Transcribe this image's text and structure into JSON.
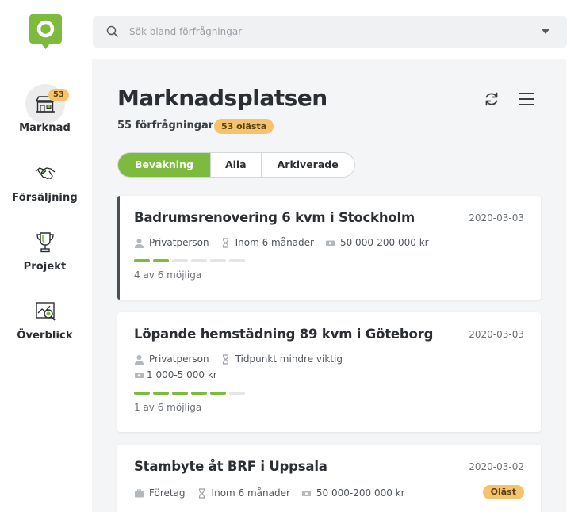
{
  "sidebar": {
    "items": [
      {
        "label": "Marknad",
        "badge": "53",
        "icon": "market-stall-icon",
        "active": true
      },
      {
        "label": "Försäljning",
        "icon": "handshake-icon"
      },
      {
        "label": "Projekt",
        "icon": "trophy-icon"
      },
      {
        "label": "Överblick",
        "icon": "analytics-icon"
      }
    ]
  },
  "search": {
    "placeholder": "Sök bland förfrågningar",
    "value": ""
  },
  "main": {
    "title": "Marknadsplatsen",
    "count_text": "55 förfrågningar",
    "unread_badge": "53 olästa",
    "tabs": [
      {
        "label": "Bevakning",
        "active": true
      },
      {
        "label": "Alla"
      },
      {
        "label": "Arkiverade"
      }
    ]
  },
  "cards": [
    {
      "title": "Badrumsrenovering 6 kvm i Stockholm",
      "date": "2020-03-03",
      "customer": "Privatperson",
      "timeframe": "Inom 6 månader",
      "budget": "50 000-200 000 kr",
      "filled": 2,
      "total": 6,
      "possible": "4 av 6 möjliga"
    },
    {
      "title": "Löpande hemstädning 89 kvm i Göteborg",
      "date": "2020-03-03",
      "customer": "Privatperson",
      "timeframe": "Tidpunkt mindre viktig",
      "budget": "1 000-5 000 kr",
      "filled": 5,
      "total": 6,
      "possible": "1 av 6 möjliga"
    },
    {
      "title": "Stambyte åt BRF i Uppsala",
      "date": "2020-03-02",
      "customer": "Företag",
      "timeframe": "Inom 6 månader",
      "budget": "50 000-200 000 kr",
      "read_badge": "Oläst"
    }
  ],
  "colors": {
    "accent": "#7dbb3f",
    "badge": "#f5c36c",
    "panel": "#f4f5f6"
  }
}
